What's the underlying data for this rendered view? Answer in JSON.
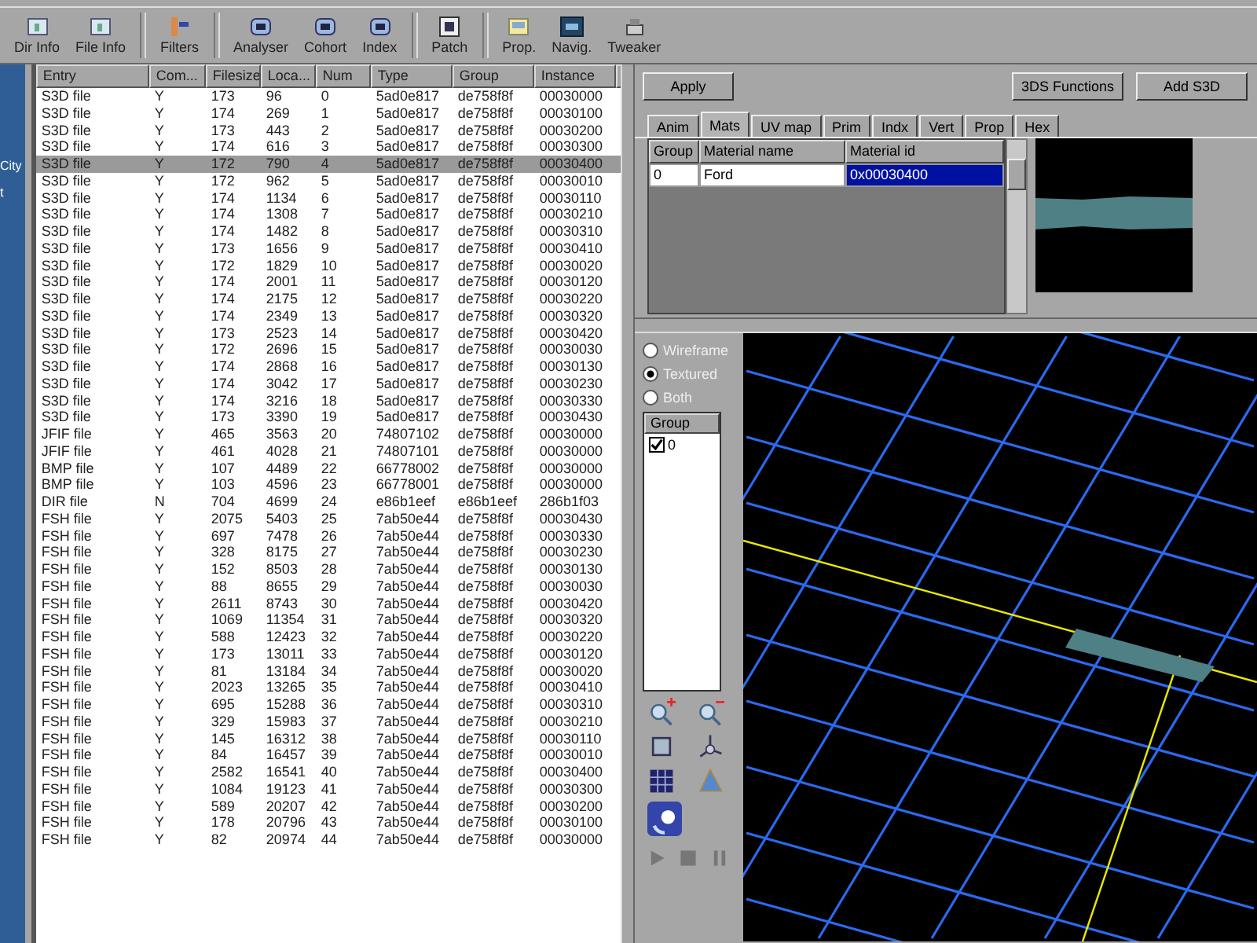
{
  "toolbar": {
    "groups": [
      [
        {
          "label": "Dir Info"
        },
        {
          "label": "File Info"
        }
      ],
      [
        {
          "label": "Filters"
        }
      ],
      [
        {
          "label": "Analyser"
        },
        {
          "label": "Cohort"
        },
        {
          "label": "Index"
        }
      ],
      [
        {
          "label": "Patch"
        }
      ],
      [
        {
          "label": "Prop."
        },
        {
          "label": "Navig."
        },
        {
          "label": "Tweaker"
        }
      ]
    ]
  },
  "sidebar": {
    "items": [
      "City",
      "t"
    ]
  },
  "table": {
    "columns": [
      "Entry",
      "Com...",
      "Filesize",
      "Loca...",
      "Num",
      "Type",
      "Group",
      "Instance"
    ],
    "rows": [
      {
        "cells": [
          "S3D file",
          "Y",
          "173",
          "96",
          "0",
          "5ad0e817",
          "de758f8f",
          "00030000"
        ],
        "selected": false
      },
      {
        "cells": [
          "S3D file",
          "Y",
          "174",
          "269",
          "1",
          "5ad0e817",
          "de758f8f",
          "00030100"
        ],
        "selected": false
      },
      {
        "cells": [
          "S3D file",
          "Y",
          "173",
          "443",
          "2",
          "5ad0e817",
          "de758f8f",
          "00030200"
        ],
        "selected": false
      },
      {
        "cells": [
          "S3D file",
          "Y",
          "174",
          "616",
          "3",
          "5ad0e817",
          "de758f8f",
          "00030300"
        ],
        "selected": false
      },
      {
        "cells": [
          "S3D file",
          "Y",
          "172",
          "790",
          "4",
          "5ad0e817",
          "de758f8f",
          "00030400"
        ],
        "selected": true
      },
      {
        "cells": [
          "S3D file",
          "Y",
          "172",
          "962",
          "5",
          "5ad0e817",
          "de758f8f",
          "00030010"
        ],
        "selected": false
      },
      {
        "cells": [
          "S3D file",
          "Y",
          "174",
          "1134",
          "6",
          "5ad0e817",
          "de758f8f",
          "00030110"
        ],
        "selected": false
      },
      {
        "cells": [
          "S3D file",
          "Y",
          "174",
          "1308",
          "7",
          "5ad0e817",
          "de758f8f",
          "00030210"
        ],
        "selected": false
      },
      {
        "cells": [
          "S3D file",
          "Y",
          "174",
          "1482",
          "8",
          "5ad0e817",
          "de758f8f",
          "00030310"
        ],
        "selected": false
      },
      {
        "cells": [
          "S3D file",
          "Y",
          "173",
          "1656",
          "9",
          "5ad0e817",
          "de758f8f",
          "00030410"
        ],
        "selected": false
      },
      {
        "cells": [
          "S3D file",
          "Y",
          "172",
          "1829",
          "10",
          "5ad0e817",
          "de758f8f",
          "00030020"
        ],
        "selected": false
      },
      {
        "cells": [
          "S3D file",
          "Y",
          "174",
          "2001",
          "11",
          "5ad0e817",
          "de758f8f",
          "00030120"
        ],
        "selected": false
      },
      {
        "cells": [
          "S3D file",
          "Y",
          "174",
          "2175",
          "12",
          "5ad0e817",
          "de758f8f",
          "00030220"
        ],
        "selected": false
      },
      {
        "cells": [
          "S3D file",
          "Y",
          "174",
          "2349",
          "13",
          "5ad0e817",
          "de758f8f",
          "00030320"
        ],
        "selected": false
      },
      {
        "cells": [
          "S3D file",
          "Y",
          "173",
          "2523",
          "14",
          "5ad0e817",
          "de758f8f",
          "00030420"
        ],
        "selected": false
      },
      {
        "cells": [
          "S3D file",
          "Y",
          "172",
          "2696",
          "15",
          "5ad0e817",
          "de758f8f",
          "00030030"
        ],
        "selected": false
      },
      {
        "cells": [
          "S3D file",
          "Y",
          "174",
          "2868",
          "16",
          "5ad0e817",
          "de758f8f",
          "00030130"
        ],
        "selected": false
      },
      {
        "cells": [
          "S3D file",
          "Y",
          "174",
          "3042",
          "17",
          "5ad0e817",
          "de758f8f",
          "00030230"
        ],
        "selected": false
      },
      {
        "cells": [
          "S3D file",
          "Y",
          "174",
          "3216",
          "18",
          "5ad0e817",
          "de758f8f",
          "00030330"
        ],
        "selected": false
      },
      {
        "cells": [
          "S3D file",
          "Y",
          "173",
          "3390",
          "19",
          "5ad0e817",
          "de758f8f",
          "00030430"
        ],
        "selected": false
      },
      {
        "cells": [
          "JFIF file",
          "Y",
          "465",
          "3563",
          "20",
          "74807102",
          "de758f8f",
          "00030000"
        ],
        "selected": false
      },
      {
        "cells": [
          "JFIF file",
          "Y",
          "461",
          "4028",
          "21",
          "74807101",
          "de758f8f",
          "00030000"
        ],
        "selected": false
      },
      {
        "cells": [
          "BMP file",
          "Y",
          "107",
          "4489",
          "22",
          "66778002",
          "de758f8f",
          "00030000"
        ],
        "selected": false
      },
      {
        "cells": [
          "BMP file",
          "Y",
          "103",
          "4596",
          "23",
          "66778001",
          "de758f8f",
          "00030000"
        ],
        "selected": false
      },
      {
        "cells": [
          "DIR file",
          "N",
          "704",
          "4699",
          "24",
          "e86b1eef",
          "e86b1eef",
          "286b1f03"
        ],
        "selected": false
      },
      {
        "cells": [
          "FSH file",
          "Y",
          "2075",
          "5403",
          "25",
          "7ab50e44",
          "de758f8f",
          "00030430"
        ],
        "selected": false
      },
      {
        "cells": [
          "FSH file",
          "Y",
          "697",
          "7478",
          "26",
          "7ab50e44",
          "de758f8f",
          "00030330"
        ],
        "selected": false
      },
      {
        "cells": [
          "FSH file",
          "Y",
          "328",
          "8175",
          "27",
          "7ab50e44",
          "de758f8f",
          "00030230"
        ],
        "selected": false
      },
      {
        "cells": [
          "FSH file",
          "Y",
          "152",
          "8503",
          "28",
          "7ab50e44",
          "de758f8f",
          "00030130"
        ],
        "selected": false
      },
      {
        "cells": [
          "FSH file",
          "Y",
          "88",
          "8655",
          "29",
          "7ab50e44",
          "de758f8f",
          "00030030"
        ],
        "selected": false
      },
      {
        "cells": [
          "FSH file",
          "Y",
          "2611",
          "8743",
          "30",
          "7ab50e44",
          "de758f8f",
          "00030420"
        ],
        "selected": false
      },
      {
        "cells": [
          "FSH file",
          "Y",
          "1069",
          "11354",
          "31",
          "7ab50e44",
          "de758f8f",
          "00030320"
        ],
        "selected": false
      },
      {
        "cells": [
          "FSH file",
          "Y",
          "588",
          "12423",
          "32",
          "7ab50e44",
          "de758f8f",
          "00030220"
        ],
        "selected": false
      },
      {
        "cells": [
          "FSH file",
          "Y",
          "173",
          "13011",
          "33",
          "7ab50e44",
          "de758f8f",
          "00030120"
        ],
        "selected": false
      },
      {
        "cells": [
          "FSH file",
          "Y",
          "81",
          "13184",
          "34",
          "7ab50e44",
          "de758f8f",
          "00030020"
        ],
        "selected": false
      },
      {
        "cells": [
          "FSH file",
          "Y",
          "2023",
          "13265",
          "35",
          "7ab50e44",
          "de758f8f",
          "00030410"
        ],
        "selected": false
      },
      {
        "cells": [
          "FSH file",
          "Y",
          "695",
          "15288",
          "36",
          "7ab50e44",
          "de758f8f",
          "00030310"
        ],
        "selected": false
      },
      {
        "cells": [
          "FSH file",
          "Y",
          "329",
          "15983",
          "37",
          "7ab50e44",
          "de758f8f",
          "00030210"
        ],
        "selected": false
      },
      {
        "cells": [
          "FSH file",
          "Y",
          "145",
          "16312",
          "38",
          "7ab50e44",
          "de758f8f",
          "00030110"
        ],
        "selected": false
      },
      {
        "cells": [
          "FSH file",
          "Y",
          "84",
          "16457",
          "39",
          "7ab50e44",
          "de758f8f",
          "00030010"
        ],
        "selected": false
      },
      {
        "cells": [
          "FSH file",
          "Y",
          "2582",
          "16541",
          "40",
          "7ab50e44",
          "de758f8f",
          "00030400"
        ],
        "selected": false
      },
      {
        "cells": [
          "FSH file",
          "Y",
          "1084",
          "19123",
          "41",
          "7ab50e44",
          "de758f8f",
          "00030300"
        ],
        "selected": false
      },
      {
        "cells": [
          "FSH file",
          "Y",
          "589",
          "20207",
          "42",
          "7ab50e44",
          "de758f8f",
          "00030200"
        ],
        "selected": false
      },
      {
        "cells": [
          "FSH file",
          "Y",
          "178",
          "20796",
          "43",
          "7ab50e44",
          "de758f8f",
          "00030100"
        ],
        "selected": false
      },
      {
        "cells": [
          "FSH file",
          "Y",
          "82",
          "20974",
          "44",
          "7ab50e44",
          "de758f8f",
          "00030000"
        ],
        "selected": false
      }
    ]
  },
  "actions": {
    "apply": "Apply",
    "right": [
      "3DS Functions",
      "Add S3D"
    ]
  },
  "tabs": [
    {
      "label": "Anim",
      "selected": false
    },
    {
      "label": "Mats",
      "selected": true
    },
    {
      "label": "UV map",
      "selected": false
    },
    {
      "label": "Prim",
      "selected": false
    },
    {
      "label": "Indx",
      "selected": false
    },
    {
      "label": "Vert",
      "selected": false
    },
    {
      "label": "Prop",
      "selected": false
    },
    {
      "label": "Hex",
      "selected": false
    }
  ],
  "materials": {
    "columns": [
      "Group",
      "Material name",
      "Material id"
    ],
    "rows": [
      {
        "group": "0",
        "name": "Ford",
        "id": "0x00030400",
        "selected": true
      }
    ]
  },
  "render_modes": [
    {
      "label": "Wireframe",
      "selected": false
    },
    {
      "label": "Textured",
      "selected": true
    },
    {
      "label": "Both",
      "selected": false
    }
  ],
  "group_list": {
    "header": "Group",
    "items": [
      {
        "label": "0",
        "checked": true
      }
    ]
  }
}
